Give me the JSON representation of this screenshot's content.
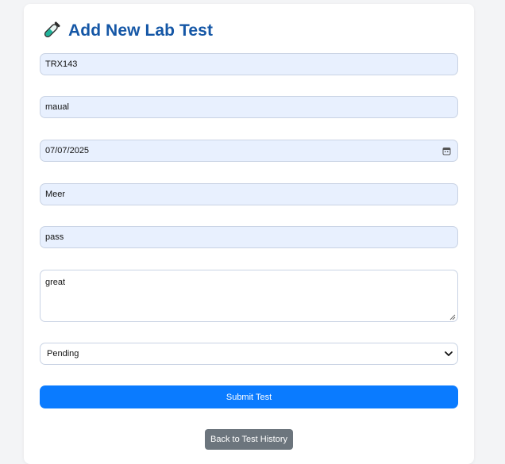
{
  "form": {
    "title": "Add New Lab Test",
    "title_icon": "test-tube-icon",
    "test_id_value": "TRX143",
    "test_type_value": "maual",
    "date_value": "07/07/2025",
    "patient_value": "Meer",
    "result_value": "pass",
    "remarks_value": "great",
    "status_selected": "Pending",
    "submit_label": "Submit Test",
    "back_label": "Back to Test History"
  },
  "colors": {
    "title": "#1557a6",
    "field_bg": "#e8f0fe",
    "submit_bg": "#0a7bff",
    "back_bg": "#6c757d"
  }
}
